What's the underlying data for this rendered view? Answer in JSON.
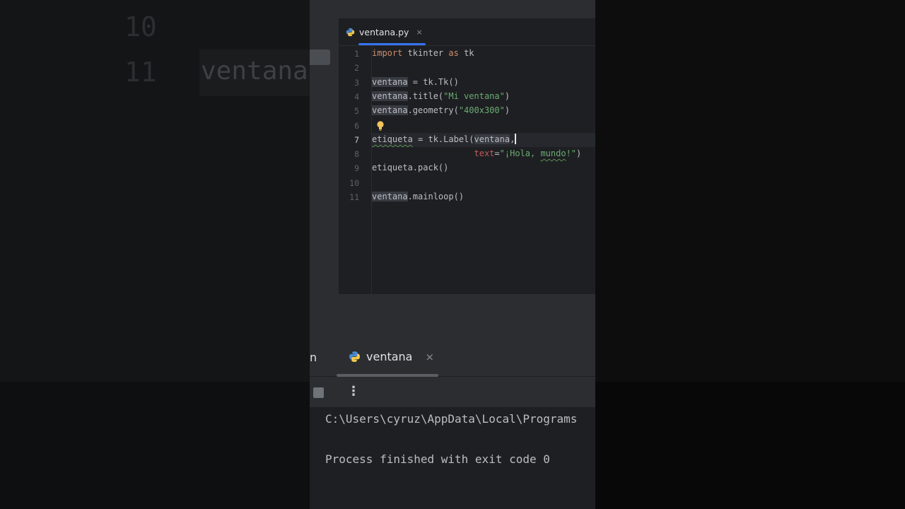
{
  "background": {
    "line_numbers": [
      "10",
      "11"
    ],
    "code_fragment": "ventana"
  },
  "editor": {
    "tab_label": "ventana.py",
    "tab_close": "×",
    "current_line": 7,
    "lines": [
      {
        "num": "1",
        "segments": [
          {
            "t": "import",
            "c": "kw"
          },
          {
            "t": " tkinter ",
            "c": ""
          },
          {
            "t": "as",
            "c": "kw"
          },
          {
            "t": " tk",
            "c": ""
          }
        ]
      },
      {
        "num": "2",
        "segments": []
      },
      {
        "num": "3",
        "segments": [
          {
            "t": "ventana",
            "c": "hl"
          },
          {
            "t": " = tk.Tk()",
            "c": ""
          }
        ]
      },
      {
        "num": "4",
        "segments": [
          {
            "t": "ventana",
            "c": "hl"
          },
          {
            "t": ".title(",
            "c": ""
          },
          {
            "t": "\"Mi ventana\"",
            "c": "str"
          },
          {
            "t": ")",
            "c": ""
          }
        ]
      },
      {
        "num": "5",
        "segments": [
          {
            "t": "ventana",
            "c": "hl"
          },
          {
            "t": ".geometry(",
            "c": ""
          },
          {
            "t": "\"400x300\"",
            "c": "str"
          },
          {
            "t": ")",
            "c": ""
          }
        ]
      },
      {
        "num": "6",
        "segments": []
      },
      {
        "num": "7",
        "segments": [
          {
            "t": "etiqueta",
            "c": "wavy"
          },
          {
            "t": " = tk.Label(",
            "c": ""
          },
          {
            "t": "ventana",
            "c": "hl"
          },
          {
            "t": ",",
            "c": ""
          },
          {
            "t": "",
            "c": "caret"
          }
        ]
      },
      {
        "num": "8",
        "segments": [
          {
            "t": "                    ",
            "c": ""
          },
          {
            "t": "text",
            "c": "param"
          },
          {
            "t": "=",
            "c": ""
          },
          {
            "t": "\"¡Hola, ",
            "c": "str"
          },
          {
            "t": "mundo",
            "c": "str wavy"
          },
          {
            "t": "!\"",
            "c": "str"
          },
          {
            "t": ")",
            "c": ""
          }
        ]
      },
      {
        "num": "9",
        "segments": [
          {
            "t": "etiqueta.pack()",
            "c": ""
          }
        ]
      },
      {
        "num": "10",
        "segments": []
      },
      {
        "num": "11",
        "segments": [
          {
            "t": "ventana",
            "c": "hl"
          },
          {
            "t": ".mainloop()",
            "c": ""
          }
        ]
      }
    ]
  },
  "run": {
    "partial_tab": "n",
    "tab_label": "ventana",
    "tab_close": "×",
    "more_label": "⋮"
  },
  "console": {
    "lines": [
      "C:\\Users\\cyruz\\AppData\\Local\\Programs",
      "",
      "Process finished with exit code 0"
    ]
  },
  "colors": {
    "keyword": "#cf8e6d",
    "string": "#6aab73",
    "param": "#c15b5b",
    "accent": "#3574f0"
  }
}
